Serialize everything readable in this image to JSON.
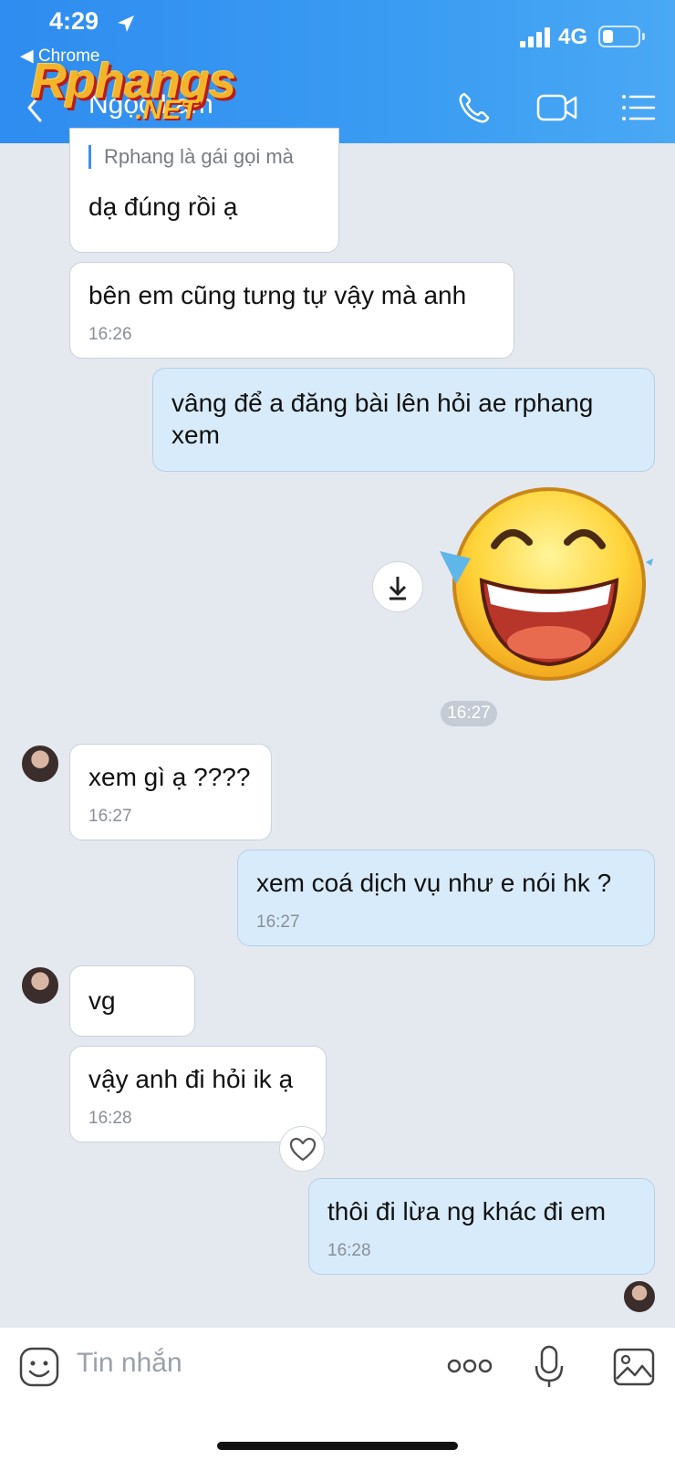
{
  "status_bar": {
    "time": "4:29",
    "back_app": "◀ Chrome",
    "network": "4G"
  },
  "header": {
    "title": "Ngọc Lam",
    "watermark": "Rphangs",
    "watermark_suffix": ".NET"
  },
  "messages": {
    "m1_quote": "Rphang là gái gọi mà",
    "m1_text": "dạ đúng rồi ạ",
    "m2_text": "bên em cũng tưng tự vậy mà anh",
    "m2_time": "16:26",
    "m3_text": "vâng để a đăng bài lên hỏi ae rphang xem",
    "sticker_time": "16:27",
    "m4_text": "xem gì ạ ????",
    "m4_time": "16:27",
    "m5_text": "xem coá dịch vụ như e nói hk ?",
    "m5_time": "16:27",
    "m6_text": "vg",
    "m7_text": "vậy anh đi hỏi ik ạ",
    "m7_time": "16:28",
    "m8_text": "thôi đi lừa ng khác đi em",
    "m8_time": "16:28"
  },
  "composer": {
    "placeholder": "Tin nhắn"
  },
  "colors": {
    "header": "#3a9cf2",
    "outgoing": "#d7ebfb",
    "incoming": "#ffffff",
    "background": "#e4e8ef"
  },
  "icons": [
    "location-arrow-icon",
    "signal-icon",
    "battery-icon",
    "back-chevron-icon",
    "phone-icon",
    "video-icon",
    "menu-list-icon",
    "download-icon",
    "heart-icon",
    "sticker-icon",
    "more-icon",
    "mic-icon",
    "image-icon"
  ]
}
